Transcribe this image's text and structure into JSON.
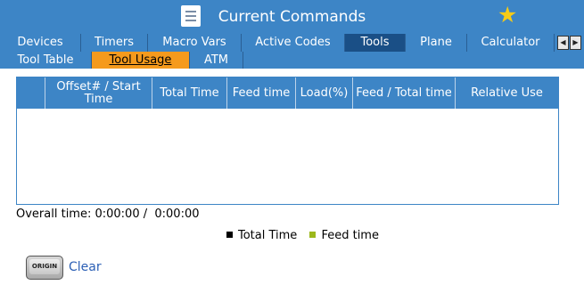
{
  "window": {
    "title": "Current Commands",
    "icons": {
      "menu": "menu-icon",
      "favorite": "star-icon"
    },
    "accent": "#3d85c6",
    "active_sub_tab_color": "#f59a1d"
  },
  "main_tabs": [
    {
      "label": "Devices"
    },
    {
      "label": "Timers"
    },
    {
      "label": "Macro Vars"
    },
    {
      "label": "Active Codes"
    },
    {
      "label": "Tools",
      "active": true
    },
    {
      "label": "Plane"
    },
    {
      "label": "Calculator"
    }
  ],
  "sub_tabs": [
    {
      "label": "Tool Table"
    },
    {
      "label": "Tool Usage",
      "active": true
    },
    {
      "label": "ATM"
    }
  ],
  "table": {
    "columns": [
      "",
      "Offset# / Start Time",
      "Total Time",
      "Feed time",
      "Load(%)",
      "Feed / Total time",
      "Relative Use"
    ],
    "rows": []
  },
  "overall": {
    "label": "Overall time:",
    "value": "0:00:00 /  0:00:00"
  },
  "legend": [
    {
      "label": "Total Time",
      "color": "#000000"
    },
    {
      "label": "Feed time",
      "color": "#9cb81c"
    }
  ],
  "actions": {
    "origin_button_text": "ORIGIN",
    "clear_label": "Clear"
  }
}
